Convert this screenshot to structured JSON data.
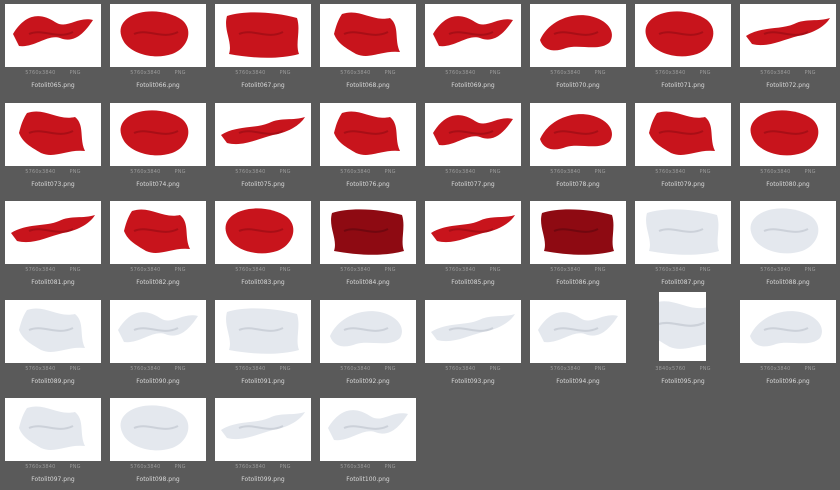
{
  "files": [
    {
      "name": "Fotolit065.png",
      "dims": "5760x3840",
      "format": "PNG",
      "color": "red",
      "shape": "wave"
    },
    {
      "name": "Fotolit066.png",
      "dims": "5760x3840",
      "format": "PNG",
      "color": "red",
      "shape": "blob"
    },
    {
      "name": "Fotolit067.png",
      "dims": "5760x3840",
      "format": "PNG",
      "color": "red",
      "shape": "cloth"
    },
    {
      "name": "Fotolit068.png",
      "dims": "5760x3840",
      "format": "PNG",
      "color": "red",
      "shape": "drape"
    },
    {
      "name": "Fotolit069.png",
      "dims": "5760x3840",
      "format": "PNG",
      "color": "red",
      "shape": "wave"
    },
    {
      "name": "Fotolit070.png",
      "dims": "5760x3840",
      "format": "PNG",
      "color": "red",
      "shape": "swirl"
    },
    {
      "name": "Fotolit071.png",
      "dims": "5760x3840",
      "format": "PNG",
      "color": "red",
      "shape": "blob"
    },
    {
      "name": "Fotolit072.png",
      "dims": "5760x3840",
      "format": "PNG",
      "color": "red",
      "shape": "ribbon"
    },
    {
      "name": "Fotolit073.png",
      "dims": "5760x3840",
      "format": "PNG",
      "color": "red",
      "shape": "drape"
    },
    {
      "name": "Fotolit074.png",
      "dims": "5760x3840",
      "format": "PNG",
      "color": "red",
      "shape": "blob"
    },
    {
      "name": "Fotolit075.png",
      "dims": "5760x3840",
      "format": "PNG",
      "color": "red",
      "shape": "ribbon"
    },
    {
      "name": "Fotolit076.png",
      "dims": "5760x3840",
      "format": "PNG",
      "color": "red",
      "shape": "drape"
    },
    {
      "name": "Fotolit077.png",
      "dims": "5760x3840",
      "format": "PNG",
      "color": "red",
      "shape": "wave"
    },
    {
      "name": "Fotolit078.png",
      "dims": "5760x3840",
      "format": "PNG",
      "color": "red",
      "shape": "swirl"
    },
    {
      "name": "Fotolit079.png",
      "dims": "5760x3840",
      "format": "PNG",
      "color": "red",
      "shape": "drape"
    },
    {
      "name": "Fotolit080.png",
      "dims": "5760x3840",
      "format": "PNG",
      "color": "red",
      "shape": "blob"
    },
    {
      "name": "Fotolit081.png",
      "dims": "5760x3840",
      "format": "PNG",
      "color": "red",
      "shape": "ribbon"
    },
    {
      "name": "Fotolit082.png",
      "dims": "5760x3840",
      "format": "PNG",
      "color": "red",
      "shape": "drape"
    },
    {
      "name": "Fotolit083.png",
      "dims": "5760x3840",
      "format": "PNG",
      "color": "red",
      "shape": "blob"
    },
    {
      "name": "Fotolit084.png",
      "dims": "5760x3840",
      "format": "PNG",
      "color": "darkred",
      "shape": "cloth"
    },
    {
      "name": "Fotolit085.png",
      "dims": "5760x3840",
      "format": "PNG",
      "color": "red",
      "shape": "ribbon"
    },
    {
      "name": "Fotolit086.png",
      "dims": "5760x3840",
      "format": "PNG",
      "color": "darkred",
      "shape": "cloth"
    },
    {
      "name": "Fotolit087.png",
      "dims": "5760x3840",
      "format": "PNG",
      "color": "white",
      "shape": "cloth"
    },
    {
      "name": "Fotolit088.png",
      "dims": "5760x3840",
      "format": "PNG",
      "color": "white",
      "shape": "blob"
    },
    {
      "name": "Fotolit089.png",
      "dims": "5760x3840",
      "format": "PNG",
      "color": "white",
      "shape": "drape"
    },
    {
      "name": "Fotolit090.png",
      "dims": "5760x3840",
      "format": "PNG",
      "color": "white",
      "shape": "wave"
    },
    {
      "name": "Fotolit091.png",
      "dims": "5760x3840",
      "format": "PNG",
      "color": "white",
      "shape": "cloth"
    },
    {
      "name": "Fotolit092.png",
      "dims": "5760x3840",
      "format": "PNG",
      "color": "white",
      "shape": "swirl"
    },
    {
      "name": "Fotolit093.png",
      "dims": "5760x3840",
      "format": "PNG",
      "color": "white",
      "shape": "ribbon"
    },
    {
      "name": "Fotolit094.png",
      "dims": "5760x3840",
      "format": "PNG",
      "color": "white",
      "shape": "wave"
    },
    {
      "name": "Fotolit095.png",
      "dims": "3840x5760",
      "format": "PNG",
      "color": "white",
      "shape": "drape",
      "portrait": true
    },
    {
      "name": "Fotolit096.png",
      "dims": "5760x3840",
      "format": "PNG",
      "color": "white",
      "shape": "swirl"
    },
    {
      "name": "Fotolit097.png",
      "dims": "5760x3840",
      "format": "PNG",
      "color": "white",
      "shape": "drape"
    },
    {
      "name": "Fotolit098.png",
      "dims": "5760x3840",
      "format": "PNG",
      "color": "white",
      "shape": "blob"
    },
    {
      "name": "Fotolit099.png",
      "dims": "5760x3840",
      "format": "PNG",
      "color": "white",
      "shape": "ribbon"
    },
    {
      "name": "Fotolit100.png",
      "dims": "5760x3840",
      "format": "PNG",
      "color": "white",
      "shape": "wave"
    }
  ],
  "colors": {
    "background": "#5a5a5a",
    "red": "#c8141c",
    "darkred": "#8e0a12",
    "white": "#e4e8ee"
  }
}
